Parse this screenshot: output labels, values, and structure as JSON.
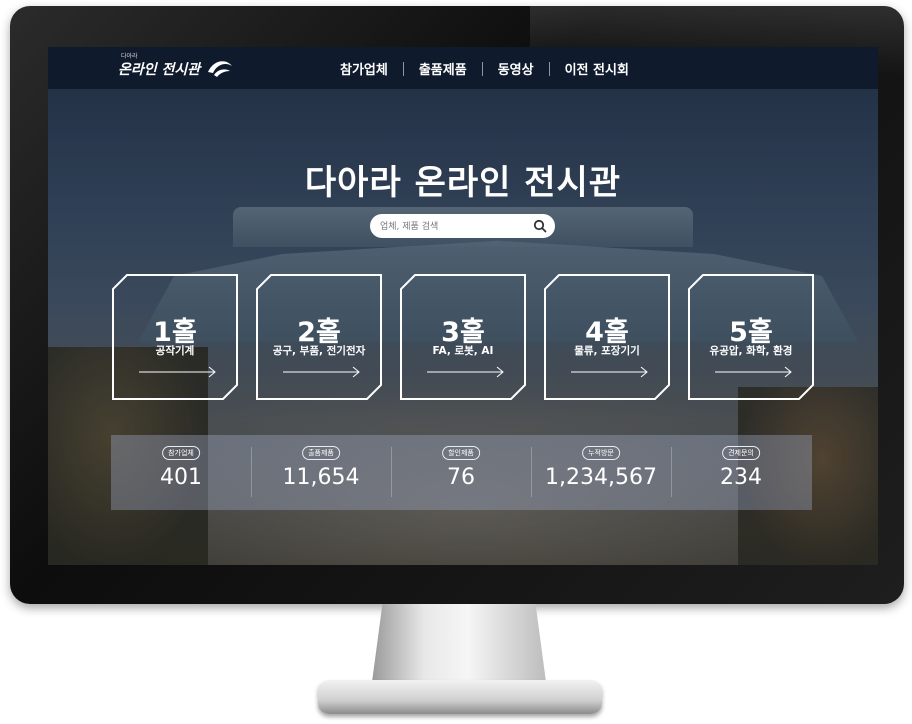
{
  "logo": {
    "text": "온라인 전시관",
    "small": "다아라"
  },
  "nav": {
    "items": [
      "참가업체",
      "출품제품",
      "동영상",
      "이전 전시회"
    ]
  },
  "hero": {
    "title": "다아라 온라인 전시관"
  },
  "search": {
    "placeholder": "업체, 제품 검색",
    "icon": "search-icon"
  },
  "halls": [
    {
      "num": "1홀",
      "category": "공작기계"
    },
    {
      "num": "2홀",
      "category": "공구, 부품, 전기전자"
    },
    {
      "num": "3홀",
      "category": "FA, 로봇, AI"
    },
    {
      "num": "4홀",
      "category": "물류, 포장기기"
    },
    {
      "num": "5홀",
      "category": "유공압, 화학, 환경"
    }
  ],
  "stats": [
    {
      "label": "참가업체",
      "value": "401"
    },
    {
      "label": "출품제품",
      "value": "11,654"
    },
    {
      "label": "할인제품",
      "value": "76"
    },
    {
      "label": "누적방문",
      "value": "1,234,567"
    },
    {
      "label": "견제문의",
      "value": "234"
    }
  ],
  "colors": {
    "topbar": "#0f1a2d",
    "monitor": "#111111",
    "text": "#ffffff"
  }
}
